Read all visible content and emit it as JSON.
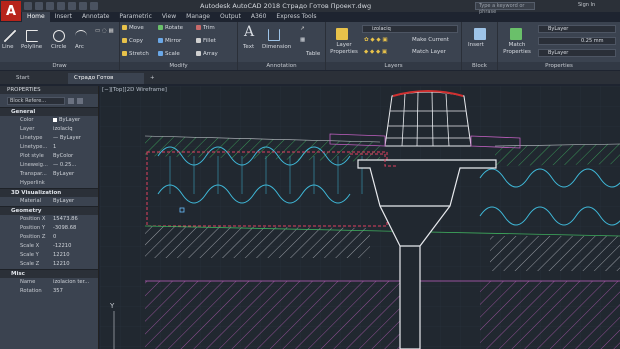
{
  "app": {
    "logo": "A",
    "title": "Autodesk AutoCAD 2018   Страдо Готов Проект.dwg",
    "search_placeholder": "Type a keyword or phrase",
    "signin": "Sign In"
  },
  "menu_tabs": [
    "Home",
    "Insert",
    "Annotate",
    "Parametric",
    "View",
    "Manage",
    "Output",
    "A360",
    "Express Tools"
  ],
  "ribbon": {
    "draw": {
      "title": "Draw",
      "tools": [
        "Line",
        "Polyline",
        "Circle",
        "Arc"
      ]
    },
    "modify": {
      "title": "Modify",
      "tools": [
        "Move",
        "Rotate",
        "Trim",
        "Copy",
        "Mirror",
        "Fillet",
        "Stretch",
        "Scale",
        "Array"
      ]
    },
    "annotation": {
      "title": "Annotation",
      "tools": [
        "Text",
        "Dimension",
        "Table"
      ]
    },
    "layers": {
      "title": "Layers",
      "properties_label": "Layer Properties",
      "current_layer": "izolaciq",
      "make_current": "Make Current",
      "match_layer": "Match Layer"
    },
    "block": {
      "title": "Block",
      "insert": "Insert"
    },
    "properties": {
      "title": "Properties",
      "match": "Match Properties",
      "color": "ByLayer",
      "lineweight": "0.25 mm",
      "linetype": "ByLayer"
    }
  },
  "file_tabs": {
    "start": "Start",
    "doc": "Страдо Готов Проект*",
    "plus": "+"
  },
  "palette": {
    "title": "PROPERTIES",
    "selection": "Block Refere...",
    "sections": {
      "general": "General",
      "viz": "3D Visualization",
      "geometry": "Geometry",
      "misc": "Misc"
    },
    "general_rows": [
      {
        "name": "Color",
        "value": "ByLayer"
      },
      {
        "name": "Layer",
        "value": "izolaciq"
      },
      {
        "name": "Linetype",
        "value": "— ByLayer"
      },
      {
        "name": "Linetype...",
        "value": "1"
      },
      {
        "name": "Plot style",
        "value": "ByColor"
      },
      {
        "name": "Lineweig...",
        "value": "— 0.25..."
      },
      {
        "name": "Transpar...",
        "value": "ByLayer"
      },
      {
        "name": "Hyperlink",
        "value": ""
      }
    ],
    "viz_rows": [
      {
        "name": "Material",
        "value": "ByLayer"
      }
    ],
    "geometry_rows": [
      {
        "name": "Position X",
        "value": "15473.86"
      },
      {
        "name": "Position Y",
        "value": "-3098.68"
      },
      {
        "name": "Position Z",
        "value": "0"
      },
      {
        "name": "Scale X",
        "value": "-12210"
      },
      {
        "name": "Scale Y",
        "value": "12210"
      },
      {
        "name": "Scale Z",
        "value": "12210"
      }
    ],
    "misc_rows": [
      {
        "name": "Name",
        "value": "izolacion ter..."
      },
      {
        "name": "Rotation",
        "value": "357"
      }
    ]
  },
  "viewport": {
    "label": "[−][Top][2D Wireframe]",
    "axis_y": "Y"
  }
}
